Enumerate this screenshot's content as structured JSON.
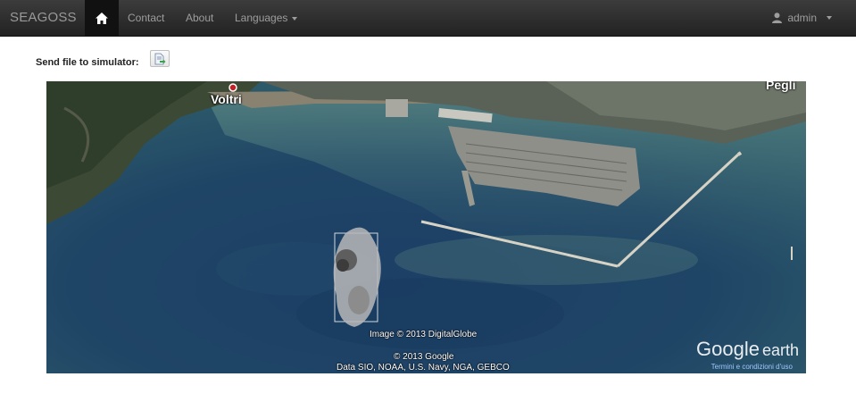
{
  "navbar": {
    "brand": "SEAGOSS",
    "home_icon": "home-icon",
    "links": {
      "contact": "Contact",
      "about": "About",
      "languages": "Languages"
    },
    "user": {
      "icon": "user-icon",
      "name": "admin"
    }
  },
  "send_file": {
    "label": "Send file to simulator:",
    "button_icon": "document-send-icon"
  },
  "map": {
    "place_voltri": "Voltri",
    "place_pegli": "Pegli",
    "image_credit": "Image © 2013 DigitalGlobe",
    "google_credit": "© 2013 Google",
    "data_credit": "Data SIO, NOAA, U.S. Navy, NGA, GEBCO",
    "logo_google": "Google",
    "logo_earth": "earth",
    "terms": "Termini e condizioni d'uso",
    "colors": {
      "sea_deep": "#1d3f5e",
      "sea_shallow": "#3f6f78",
      "land": "#3a4a34"
    }
  }
}
